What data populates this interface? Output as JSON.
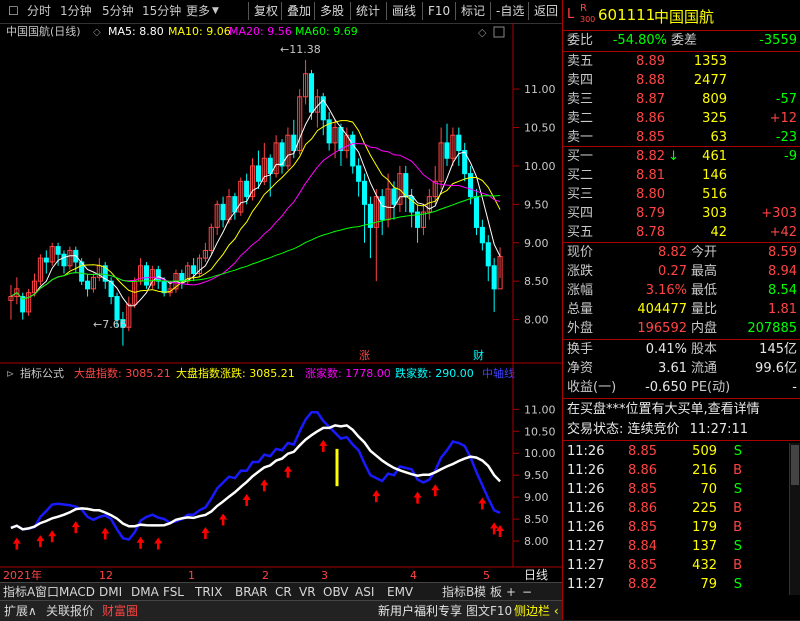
{
  "toolbar": {
    "periods": [
      "分时",
      "1分钟",
      "5分钟",
      "15分钟",
      "更多"
    ],
    "buttons": [
      "复权",
      "叠加",
      "多股",
      "统计",
      "画线",
      "F10",
      "标记",
      "-自选",
      "返回"
    ]
  },
  "kline": {
    "title": "中国国航(日线)",
    "ma5_label": "MA5: 8.80",
    "ma10_label": "MA10: 9.06",
    "ma20_label": "MA20: 9.56",
    "ma60_label": "MA60: 9.69",
    "high_mark": "11.38",
    "low_mark": "7.66",
    "marker_zhang": "涨",
    "marker_cai": "财",
    "y_ticks": [
      "11.00",
      "10.50",
      "10.00",
      "9.50",
      "9.00",
      "8.50",
      "8.00"
    ]
  },
  "indicator": {
    "name": "指标公式",
    "f1_label": "大盘指数: 3085.21",
    "f2_label": "大盘指数涨跌: 3085.21",
    "f3_label": "涨家数: 1778.00",
    "f4_label": "跌家数: 290.00",
    "f5_label": "中轴线",
    "y_ticks": [
      "11.00",
      "10.50",
      "10.00",
      "9.50",
      "9.00",
      "8.50",
      "8.00"
    ]
  },
  "x_axis": {
    "labels": [
      "2021年",
      "12",
      "1",
      "2",
      "3",
      "4",
      "5"
    ],
    "period": "日线"
  },
  "indicator_tabs": [
    "指标A",
    "窗口",
    "MACD",
    "DMI",
    "DMA",
    "FSL",
    "TRIX",
    "BRAR",
    "CR",
    "VR",
    "OBV",
    "ASI",
    "EMV",
    "指标B",
    "模",
    "板",
    "+",
    "−"
  ],
  "status_bar": {
    "left": [
      "扩展∧",
      "关联报价",
      "财富圈"
    ],
    "ad": "新用户福利专享",
    "mid": [
      "图文F10",
      "侧边栏 ‹"
    ],
    "right": [
      "笔",
      "价",
      "细",
      "势",
      "联",
      "值",
      "主",
      "筹"
    ]
  },
  "quote": {
    "badge_l": "L",
    "badge_r": "R",
    "badge_num": "300",
    "code": "601111",
    "name": "中国国航",
    "weibi_label": "委比",
    "weibi": "-54.80%",
    "weicha_label": "委差",
    "weicha": "-3559",
    "sells": [
      {
        "label": "卖五",
        "price": "8.89",
        "vol": "1353",
        "chg": ""
      },
      {
        "label": "卖四",
        "price": "8.88",
        "vol": "2477",
        "chg": ""
      },
      {
        "label": "卖三",
        "price": "8.87",
        "vol": "809",
        "chg": "-57"
      },
      {
        "label": "卖二",
        "price": "8.86",
        "vol": "325",
        "chg": "+12"
      },
      {
        "label": "卖一",
        "price": "8.85",
        "vol": "63",
        "chg": "-23"
      }
    ],
    "buys": [
      {
        "label": "买一",
        "price": "8.82",
        "vol": "461",
        "chg": "-9",
        "arrow": "↓"
      },
      {
        "label": "买二",
        "price": "8.81",
        "vol": "146",
        "chg": "",
        "arrow": ""
      },
      {
        "label": "买三",
        "price": "8.80",
        "vol": "516",
        "chg": "",
        "arrow": ""
      },
      {
        "label": "买四",
        "price": "8.79",
        "vol": "303",
        "chg": "+303",
        "arrow": ""
      },
      {
        "label": "买五",
        "price": "8.78",
        "vol": "42",
        "chg": "+42",
        "arrow": ""
      }
    ],
    "stats": [
      {
        "l1": "现价",
        "v1": "8.82",
        "l2": "今开",
        "v2": "8.59"
      },
      {
        "l1": "涨跌",
        "v1": "0.27",
        "l2": "最高",
        "v2": "8.94"
      },
      {
        "l1": "涨幅",
        "v1": "3.16%",
        "l2": "最低",
        "v2": "8.54"
      },
      {
        "l1": "总量",
        "v1": "404477",
        "l2": "量比",
        "v2": "1.81"
      },
      {
        "l1": "外盘",
        "v1": "196592",
        "l2": "内盘",
        "v2": "207885"
      }
    ],
    "fin": [
      {
        "l1": "换手",
        "v1": "0.41%",
        "l2": "股本",
        "v2": "145亿"
      },
      {
        "l1": "净资",
        "v1": "3.61",
        "l2": "流通",
        "v2": "99.6亿"
      },
      {
        "l1": "收益(一)",
        "v1": "-0.650",
        "l2": "PE(动)",
        "v2": "-"
      }
    ],
    "notice": "在买盘***位置有大买单,查看详情",
    "trade_status_label": "交易状态: 连续竞价",
    "trade_status_time": "11:27:11",
    "ticks": [
      {
        "time": "11:26",
        "price": "8.85",
        "vol": "509",
        "bs": "S"
      },
      {
        "time": "11:26",
        "price": "8.86",
        "vol": "216",
        "bs": "B"
      },
      {
        "time": "11:26",
        "price": "8.85",
        "vol": "70",
        "bs": "S"
      },
      {
        "time": "11:26",
        "price": "8.86",
        "vol": "225",
        "bs": "B"
      },
      {
        "time": "11:26",
        "price": "8.85",
        "vol": "179",
        "bs": "B"
      },
      {
        "time": "11:27",
        "price": "8.84",
        "vol": "137",
        "bs": "S"
      },
      {
        "time": "11:27",
        "price": "8.85",
        "vol": "432",
        "bs": "B"
      },
      {
        "time": "11:27",
        "price": "8.82",
        "vol": "79",
        "bs": "S"
      }
    ]
  },
  "colors": {
    "up": "#ff4444",
    "down": "#00ffff",
    "ma5": "#ffffff",
    "ma10": "#ffff00",
    "ma20": "#ff00ff",
    "ma60": "#00ff00",
    "ind_blue": "#1a1aff",
    "ind_white": "#ffffff",
    "arrow": "#ff0000"
  },
  "chart_data": {
    "type": "candlestick",
    "title": "中国国航(日线)",
    "ylim": [
      7.5,
      11.6
    ],
    "price_high": 11.38,
    "price_low": 7.66,
    "candles": [
      [
        8.25,
        8.3,
        8.45,
        8.0
      ],
      [
        8.3,
        8.4,
        8.55,
        8.2
      ],
      [
        8.3,
        8.1,
        8.35,
        8.0
      ],
      [
        8.1,
        8.35,
        8.4,
        8.05
      ],
      [
        8.35,
        8.5,
        8.6,
        8.3
      ],
      [
        8.5,
        8.8,
        8.85,
        8.45
      ],
      [
        8.8,
        8.75,
        8.9,
        8.6
      ],
      [
        8.75,
        8.95,
        9.0,
        8.7
      ],
      [
        8.95,
        8.85,
        9.0,
        8.7
      ],
      [
        8.85,
        8.7,
        8.9,
        8.6
      ],
      [
        8.7,
        8.9,
        8.95,
        8.65
      ],
      [
        8.9,
        8.75,
        8.95,
        8.6
      ],
      [
        8.75,
        8.5,
        8.8,
        8.45
      ],
      [
        8.5,
        8.4,
        8.6,
        8.3
      ],
      [
        8.4,
        8.55,
        8.6,
        8.35
      ],
      [
        8.55,
        8.7,
        8.8,
        8.5
      ],
      [
        8.7,
        8.5,
        8.75,
        8.4
      ],
      [
        8.5,
        8.3,
        8.55,
        8.2
      ],
      [
        8.3,
        8.0,
        8.35,
        7.9
      ],
      [
        8.0,
        7.9,
        8.1,
        7.66
      ],
      [
        7.9,
        8.2,
        8.3,
        7.85
      ],
      [
        8.2,
        8.5,
        8.55,
        8.15
      ],
      [
        8.5,
        8.7,
        8.8,
        8.45
      ],
      [
        8.7,
        8.45,
        8.75,
        8.4
      ],
      [
        8.45,
        8.65,
        8.7,
        8.4
      ],
      [
        8.65,
        8.5,
        8.7,
        8.4
      ],
      [
        8.5,
        8.35,
        8.55,
        8.3
      ],
      [
        8.35,
        8.4,
        8.5,
        8.3
      ],
      [
        8.4,
        8.6,
        8.65,
        8.35
      ],
      [
        8.6,
        8.5,
        8.65,
        8.4
      ],
      [
        8.5,
        8.7,
        8.75,
        8.45
      ],
      [
        8.7,
        8.6,
        8.8,
        8.5
      ],
      [
        8.6,
        8.8,
        8.85,
        8.55
      ],
      [
        8.8,
        8.9,
        9.0,
        8.75
      ],
      [
        8.9,
        9.2,
        9.25,
        8.85
      ],
      [
        9.2,
        9.5,
        9.55,
        9.1
      ],
      [
        9.5,
        9.3,
        9.6,
        9.2
      ],
      [
        9.3,
        9.6,
        9.7,
        9.25
      ],
      [
        9.6,
        9.4,
        9.65,
        9.3
      ],
      [
        9.4,
        9.8,
        9.85,
        9.35
      ],
      [
        9.8,
        9.6,
        9.9,
        9.5
      ],
      [
        9.6,
        10.0,
        10.1,
        9.55
      ],
      [
        10.0,
        9.8,
        10.2,
        9.7
      ],
      [
        9.8,
        10.1,
        10.3,
        9.75
      ],
      [
        10.1,
        9.9,
        10.15,
        9.6
      ],
      [
        9.9,
        10.3,
        10.4,
        9.85
      ],
      [
        10.3,
        10.0,
        10.35,
        9.9
      ],
      [
        10.0,
        10.4,
        10.5,
        9.95
      ],
      [
        10.4,
        10.2,
        10.6,
        10.1
      ],
      [
        10.2,
        10.9,
        11.0,
        10.15
      ],
      [
        10.9,
        11.2,
        11.38,
        10.8
      ],
      [
        11.2,
        10.7,
        11.25,
        10.6
      ],
      [
        10.7,
        10.9,
        11.0,
        10.5
      ],
      [
        10.9,
        10.6,
        10.95,
        10.4
      ],
      [
        10.6,
        10.3,
        10.7,
        10.2
      ],
      [
        10.3,
        10.5,
        10.6,
        10.1
      ],
      [
        10.5,
        10.2,
        10.55,
        10.0
      ],
      [
        10.2,
        10.4,
        10.5,
        10.1
      ],
      [
        10.4,
        10.0,
        10.45,
        9.9
      ],
      [
        10.0,
        9.8,
        10.1,
        9.6
      ],
      [
        9.8,
        9.5,
        9.9,
        9.0
      ],
      [
        9.5,
        9.2,
        9.6,
        8.8
      ],
      [
        9.2,
        9.6,
        9.7,
        8.5
      ],
      [
        9.6,
        9.3,
        9.7,
        9.1
      ],
      [
        9.3,
        9.7,
        9.9,
        9.2
      ],
      [
        9.7,
        9.5,
        9.8,
        9.3
      ],
      [
        9.5,
        9.9,
        10.0,
        9.4
      ],
      [
        9.9,
        9.6,
        10.0,
        9.4
      ],
      [
        9.6,
        9.4,
        9.7,
        9.2
      ],
      [
        9.4,
        9.2,
        9.5,
        9.0
      ],
      [
        9.2,
        9.4,
        9.5,
        9.1
      ],
      [
        9.4,
        9.6,
        9.7,
        9.3
      ],
      [
        9.6,
        9.8,
        10.0,
        9.5
      ],
      [
        9.8,
        10.3,
        10.5,
        9.7
      ],
      [
        10.3,
        10.1,
        10.55,
        10.0
      ],
      [
        10.1,
        10.4,
        10.5,
        10.0
      ],
      [
        10.4,
        10.2,
        10.5,
        10.0
      ],
      [
        10.2,
        9.9,
        10.3,
        9.8
      ],
      [
        9.9,
        9.6,
        10.0,
        9.5
      ],
      [
        9.6,
        9.2,
        9.7,
        9.1
      ],
      [
        9.2,
        9.0,
        9.3,
        8.9
      ],
      [
        9.0,
        8.7,
        9.1,
        8.5
      ],
      [
        8.7,
        8.4,
        8.8,
        8.1
      ],
      [
        8.4,
        8.82,
        8.94,
        8.54
      ]
    ]
  }
}
